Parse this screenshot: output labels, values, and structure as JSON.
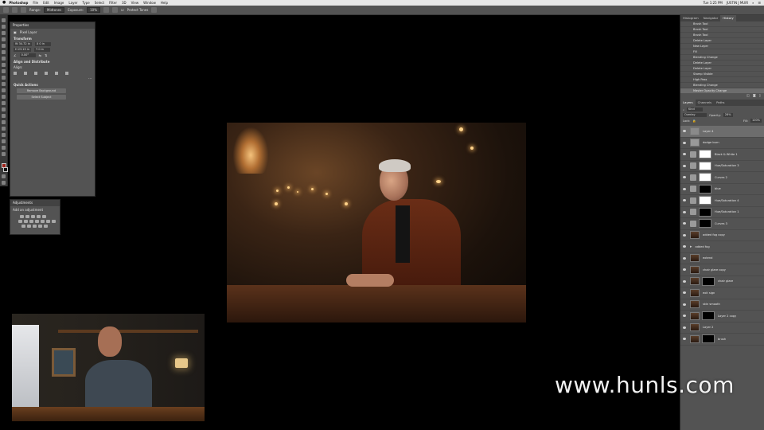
{
  "menubar": {
    "app_name": "Photoshop",
    "items": [
      "File",
      "Edit",
      "Image",
      "Layer",
      "Type",
      "Select",
      "Filter",
      "3D",
      "View",
      "Window",
      "Help"
    ],
    "time": "Tue 1:25 PM",
    "user": "JUSTIN J MUIR"
  },
  "options": {
    "range_label": "Range:",
    "range_value": "Midtones",
    "exposure_label": "Exposure:",
    "exposure_value": "10%",
    "protect_tones": "Protect Tones"
  },
  "properties": {
    "tab": "Properties",
    "layer_type": "Pixel Layer",
    "transform_header": "Transform",
    "w": "W 34.72 in",
    "x": "X 0 in",
    "h": "H 23.15 in",
    "y": "Y 0 in",
    "angle": "0.00°",
    "align_header": "Align and Distribute",
    "align_label": "Align:",
    "quick_header": "Quick Actions",
    "remove_bg": "Remove Background",
    "select_subject": "Select Subject"
  },
  "adjustments": {
    "tab": "Adjustments",
    "add_label": "Add an adjustment"
  },
  "history": {
    "tabs": [
      "Histogram",
      "Navigator",
      "History"
    ],
    "items": [
      "Brush Tool",
      "Brush Tool",
      "Brush Tool",
      "Delete Layer",
      "New Layer",
      "Fill",
      "Blending Change",
      "Delete Layer",
      "Delete Layer",
      "Stamp Visible",
      "High Pass",
      "Blending Change",
      "Master Opacity Change"
    ]
  },
  "layers": {
    "tabs": [
      "Layers",
      "Channels",
      "Paths"
    ],
    "kind_label": "Kind",
    "blend_mode": "Overlay",
    "opacity_label": "Opacity:",
    "opacity_value": "28%",
    "lock_label": "Lock:",
    "fill_label": "Fill:",
    "fill_value": "100%",
    "items": [
      {
        "name": "Layer 4",
        "selected": true
      },
      {
        "name": "dodge burn"
      },
      {
        "name": "Black & White 1"
      },
      {
        "name": "Hue/Saturation 3"
      },
      {
        "name": "Curves 2"
      },
      {
        "name": "blue"
      },
      {
        "name": "Hue/Saturation 4"
      },
      {
        "name": "Hue/Saturation 1"
      },
      {
        "name": "Curves 3"
      },
      {
        "name": "added fog copy"
      },
      {
        "name": "added fog"
      },
      {
        "name": "extend"
      },
      {
        "name": "chair glare copy"
      },
      {
        "name": "chair glare"
      },
      {
        "name": "exit sign"
      },
      {
        "name": "skin smooth"
      },
      {
        "name": "Layer 2 copy"
      },
      {
        "name": "Layer 2"
      },
      {
        "name": "brush"
      }
    ]
  },
  "watermark": "www.hunls.com",
  "colors": {
    "foreground": "#a0241c",
    "background": "#111111",
    "panel": "#535353"
  }
}
